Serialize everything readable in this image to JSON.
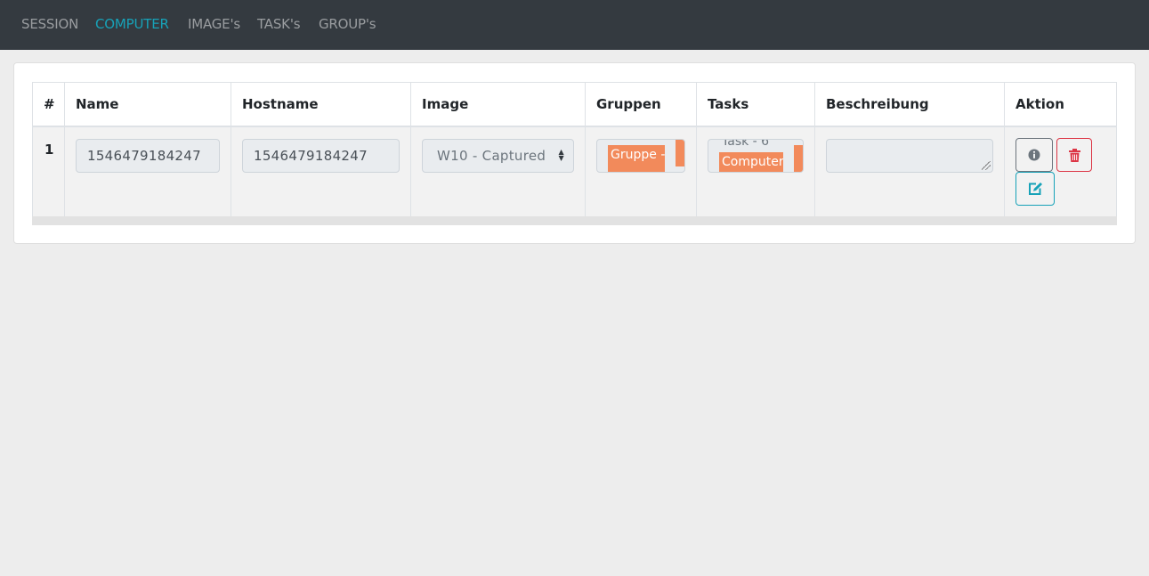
{
  "nav": {
    "items": [
      {
        "label": "SESSION"
      },
      {
        "label": "COMPUTER"
      },
      {
        "label": "IMAGE's"
      },
      {
        "label": "TASK's"
      },
      {
        "label": "GROUP's"
      }
    ]
  },
  "table": {
    "columns": [
      "#",
      "Name",
      "Hostname",
      "Image",
      "Gruppen",
      "Tasks",
      "Beschreibung",
      "Aktion"
    ],
    "rows": [
      {
        "index": "1",
        "name": "1546479184247",
        "hostname": "1546479184247",
        "image": "W10 - Captured",
        "gruppen_tag": "Gruppe - G",
        "tasks_ghost": "Task - 6",
        "tasks_tag": "Computer T",
        "beschreibung": ""
      }
    ]
  },
  "colors": {
    "navbar": "#343a40",
    "active_link": "#17a2b8",
    "tag": "#f28a5b",
    "danger": "#dc3545",
    "info": "#17a2b8"
  },
  "icons": [
    "info-circle-icon",
    "trash-icon",
    "edit-icon"
  ]
}
